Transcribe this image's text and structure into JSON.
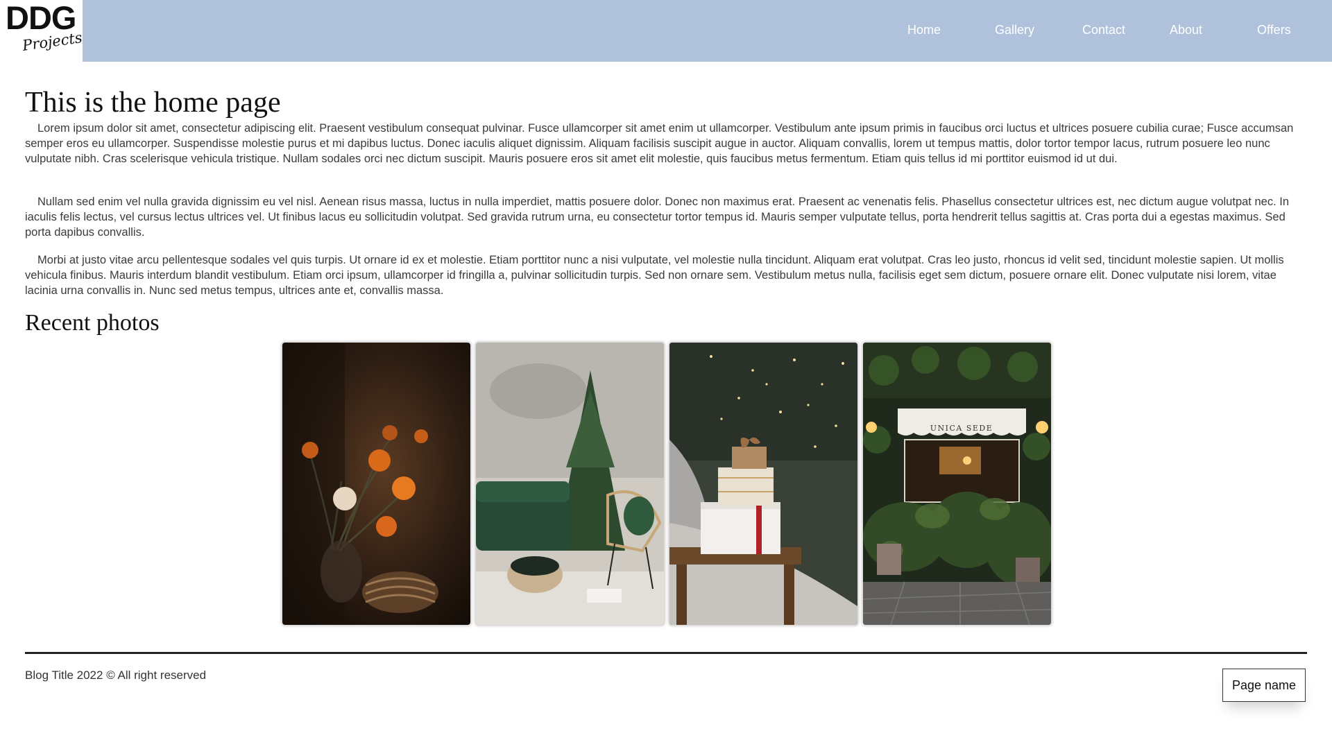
{
  "header": {
    "logo": {
      "main": "DDG",
      "sub": "Projects"
    },
    "nav": [
      "Home",
      "Gallery",
      "Contact",
      "About",
      "Offers"
    ],
    "background": "#afc1db"
  },
  "main": {
    "title": "This is the home page",
    "paragraphs": [
      "Lorem ipsum dolor sit amet, consectetur adipiscing elit. Praesent vestibulum consequat pulvinar. Fusce ullamcorper sit amet enim ut ullamcorper. Vestibulum ante ipsum primis in faucibus orci luctus et ultrices posuere cubilia curae; Fusce accumsan semper eros eu ullamcorper. Suspendisse molestie purus et mi dapibus luctus. Donec iaculis aliquet dignissim. Aliquam facilisis suscipit augue in auctor. Aliquam convallis, lorem ut tempus mattis, dolor tortor tempor lacus, rutrum posuere leo nunc vulputate nibh. Cras scelerisque vehicula tristique. Nullam sodales orci nec dictum suscipit. Mauris posuere eros sit amet elit molestie, quis faucibus metus fermentum. Etiam quis tellus id mi porttitor euismod id ut dui.",
      "Nullam sed enim vel nulla gravida dignissim eu vel nisl. Aenean risus massa, luctus in nulla imperdiet, mattis posuere dolor. Donec non maximus erat. Praesent ac venenatis felis. Phasellus consectetur ultrices est, nec dictum augue volutpat nec. In iaculis felis lectus, vel cursus lectus ultrices vel. Ut finibus lacus eu sollicitudin volutpat. Sed gravida rutrum urna, eu consectetur tortor tempus id. Mauris semper vulputate tellus, porta hendrerit tellus sagittis at. Cras porta dui a egestas maximus. Sed porta dapibus convallis.",
      "Morbi at justo vitae arcu pellentesque sodales vel quis turpis. Ut ornare id ex et molestie. Etiam porttitor nunc a nisi vulputate, vel molestie nulla tincidunt. Aliquam erat volutpat. Cras leo justo, rhoncus id velit sed, tincidunt molestie sapien. Ut mollis vehicula finibus. Mauris interdum blandit vestibulum. Etiam orci ipsum, ullamcorper id fringilla a, pulvinar sollicitudin turpis. Sed non ornare sem. Vestibulum metus nulla, facilisis eget sem dictum, posuere ornare elit. Donec vulputate nisi lorem, vitae lacinia urna convallis in. Nunc sed metus tempus, ultrices ante et, convallis massa."
    ],
    "recent_title": "Recent photos",
    "photos": [
      {
        "icon": "poppies-vase-photo"
      },
      {
        "icon": "christmas-tree-living-room-photo"
      },
      {
        "icon": "gift-boxes-bed-photo"
      },
      {
        "icon": "shopfront-plants-photo",
        "sign": "UNICA SEDE"
      }
    ]
  },
  "footer": {
    "copyright": "Blog Title 2022 © All right reserved",
    "button": "Page name"
  }
}
